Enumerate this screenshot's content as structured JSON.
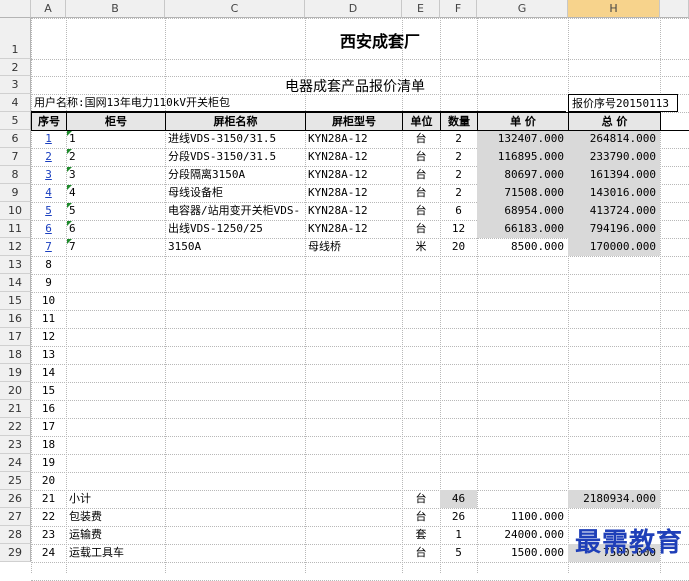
{
  "columns": [
    "A",
    "B",
    "C",
    "D",
    "E",
    "F",
    "G",
    "H"
  ],
  "selected_column": "H",
  "row_numbers": [
    1,
    2,
    3,
    4,
    5,
    6,
    7,
    8,
    9,
    10,
    11,
    12,
    13,
    14,
    15,
    16,
    17,
    18,
    19,
    20,
    21,
    22,
    23,
    24,
    25,
    26,
    27,
    28,
    29
  ],
  "title": "西安成套厂",
  "subtitle": "电器成套产品报价清单",
  "customer": "用户名称:国网13年电力110kV开关柜包",
  "quote_no": "报价序号20150113",
  "headers": [
    "序号",
    "柜号",
    "屏柜名称",
    "屏柜型号",
    "单位",
    "数量",
    "单 价",
    "总 价"
  ],
  "items": [
    {
      "seq": "1",
      "cab": "1",
      "name": "进线VDS-3150/31.5",
      "model": "KYN28A-12",
      "unit": "台",
      "qty": "2",
      "price": "132407.000",
      "total": "264814.000"
    },
    {
      "seq": "2",
      "cab": "2",
      "name": "分段VDS-3150/31.5",
      "model": "KYN28A-12",
      "unit": "台",
      "qty": "2",
      "price": "116895.000",
      "total": "233790.000"
    },
    {
      "seq": "3",
      "cab": "3",
      "name": "分段隔离3150A",
      "model": "KYN28A-12",
      "unit": "台",
      "qty": "2",
      "price": "80697.000",
      "total": "161394.000"
    },
    {
      "seq": "4",
      "cab": "4",
      "name": "母线设备柜",
      "model": "KYN28A-12",
      "unit": "台",
      "qty": "2",
      "price": "71508.000",
      "total": "143016.000"
    },
    {
      "seq": "5",
      "cab": "5",
      "name": "电容器/站用变开关柜VDS-",
      "model": "KYN28A-12",
      "unit": "台",
      "qty": "6",
      "price": "68954.000",
      "total": "413724.000"
    },
    {
      "seq": "6",
      "cab": "6",
      "name": "出线VDS-1250/25",
      "model": "KYN28A-12",
      "unit": "台",
      "qty": "12",
      "price": "66183.000",
      "total": "794196.000"
    },
    {
      "seq": "7",
      "cab": "7",
      "name": "3150A",
      "model": "母线桥",
      "unit": "米",
      "qty": "20",
      "price": "8500.000",
      "total": "170000.000"
    }
  ],
  "empty_seq": [
    "8",
    "9",
    "10",
    "11",
    "12",
    "13",
    "14",
    "15",
    "16",
    "17",
    "18",
    "19",
    "20"
  ],
  "footer": [
    {
      "seq": "21",
      "cab": "小计",
      "unit": "台",
      "qty": "46",
      "price": "",
      "total": "2180934.000"
    },
    {
      "seq": "22",
      "cab": "包装费",
      "unit": "台",
      "qty": "26",
      "price": "1100.000",
      "total": ""
    },
    {
      "seq": "23",
      "cab": "运输费",
      "unit": "套",
      "qty": "1",
      "price": "24000.000",
      "total": ""
    },
    {
      "seq": "24",
      "cab": "运载工具车",
      "unit": "台",
      "qty": "5",
      "price": "1500.000",
      "total": "7500.000"
    }
  ],
  "watermark": "最需教育"
}
